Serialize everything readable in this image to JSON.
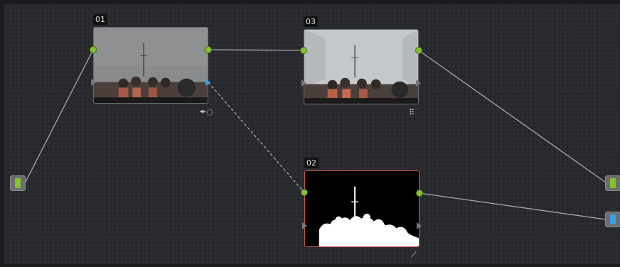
{
  "nodes": [
    {
      "label": "01",
      "tool_icons": [
        "eyedropper-icon",
        "circular-window-icon"
      ],
      "tool_text": "✒◌"
    },
    {
      "label": "03",
      "tool_icons": [
        "grid-icon"
      ],
      "tool_text": "⠿"
    },
    {
      "label": "02",
      "tool_icons": [
        "curve-icon"
      ],
      "tool_text": "⟋"
    }
  ],
  "colors": {
    "connector_green": "#85c22b",
    "connector_blue": "#3aa0e6",
    "selected_border": "#d2574a",
    "wire": "#a7a8ab"
  },
  "io": {
    "source_input": "rgb",
    "output_rgb": "rgb",
    "output_alpha": "alpha"
  }
}
